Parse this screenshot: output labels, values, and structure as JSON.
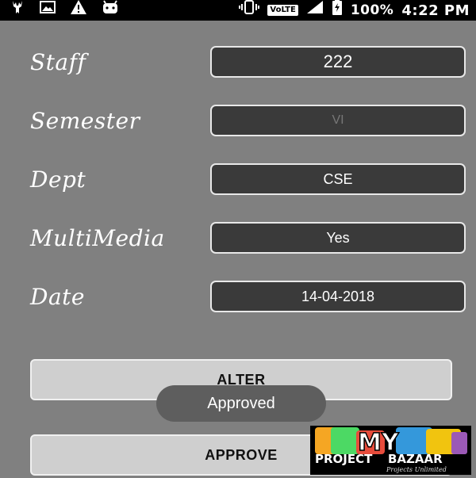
{
  "status_bar": {
    "left_icons": [
      "deer-icon",
      "image-icon",
      "warning-icon",
      "android-icon"
    ],
    "right_icons": [
      "vibrate-icon",
      "volte-badge",
      "signal-icon",
      "battery-charging-icon"
    ],
    "volte_label": "VoLTE",
    "battery_percent": "100%",
    "time": "4:22 PM"
  },
  "form": {
    "staff": {
      "label": "Staff",
      "value": "222"
    },
    "semester": {
      "label": "Semester",
      "value": "VI"
    },
    "dept": {
      "label": "Dept",
      "value": "CSE"
    },
    "multimedia": {
      "label": "MultiMedia",
      "value": "Yes"
    },
    "date": {
      "label": "Date",
      "value": "14-04-2018"
    }
  },
  "buttons": {
    "alter_label": "ALTER",
    "approve_label": "APPROVE"
  },
  "toast": {
    "message": "Approved"
  },
  "watermark": {
    "brand_top": "MY",
    "brand_main_left": "PROJECT",
    "brand_main_right": "BAZAAR",
    "tagline": "Projects Unlimited"
  },
  "colors": {
    "background": "#808080",
    "field_bg": "#3a3a3a",
    "button_bg": "#cfcfcf",
    "toast_bg": "#5e5e5e"
  }
}
